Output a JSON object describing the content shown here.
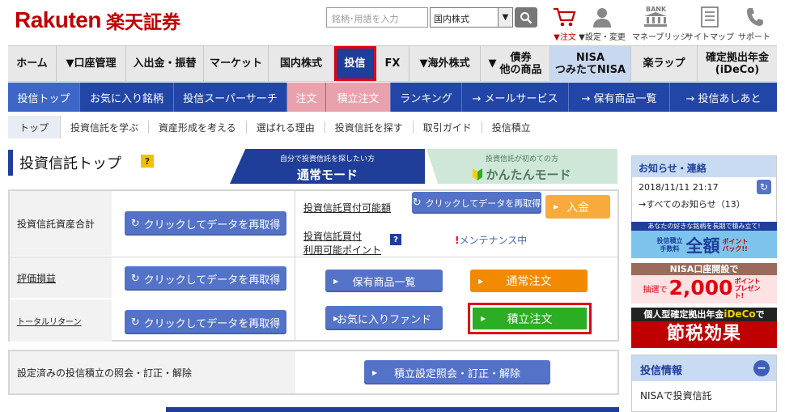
{
  "header": {
    "logo_latin": "Rakuten",
    "logo_jp": "楽天証券",
    "search_placeholder": "銘柄･用語を入力",
    "search_category": "国内株式",
    "icons": [
      {
        "name": "cart-icon",
        "label": "▼注文"
      },
      {
        "name": "user-icon",
        "label": "▼設定・変更"
      },
      {
        "name": "bank-icon",
        "label": "マネーブリッジ",
        "badge": "BANK"
      },
      {
        "name": "sitemap-icon",
        "label": "サイトマップ"
      },
      {
        "name": "phone-icon",
        "label": "サポート"
      }
    ]
  },
  "main_nav": [
    {
      "label": "ホーム"
    },
    {
      "label": "▼口座管理"
    },
    {
      "label": "入出金・振替"
    },
    {
      "label": "マーケット"
    },
    {
      "label": "国内株式"
    },
    {
      "label": "投信"
    },
    {
      "label": "FX"
    },
    {
      "label": "▼海外株式"
    },
    {
      "label": "▼",
      "label2": "債券",
      "label3": "他の商品"
    },
    {
      "label": "NISA",
      "label2": "つみたてNISA"
    },
    {
      "label": "楽ラップ"
    },
    {
      "label": "確定拠出年金",
      "label2": "(iDeCo)"
    }
  ],
  "sub_nav": [
    {
      "label": "投信トップ"
    },
    {
      "label": "お気に入り銘柄"
    },
    {
      "label": "投信スーパーサーチ"
    },
    {
      "label": "注文"
    },
    {
      "label": "積立注文"
    },
    {
      "label": "ランキング"
    },
    {
      "label": "→ メールサービス"
    },
    {
      "label": "→ 保有商品一覧"
    },
    {
      "label": "→ 投信あしあと"
    }
  ],
  "tert_nav": [
    {
      "label": "トップ"
    },
    {
      "label": "投資信託を学ぶ"
    },
    {
      "label": "資産形成を考える"
    },
    {
      "label": "選ばれる理由"
    },
    {
      "label": "投資信託を探す"
    },
    {
      "label": "取引ガイド"
    },
    {
      "label": "投信積立"
    }
  ],
  "page": {
    "title": "投資信託トップ",
    "help": "?",
    "mode_normal_sub": "自分で投資信託を探したい方",
    "mode_normal_main": "通常モード",
    "mode_easy_sub": "投資信託が初めての方",
    "mode_easy_main": "かんたんモード"
  },
  "panel": {
    "asset_total_label": "投資信託資産合計",
    "refresh_label": "クリックしてデータを再取得",
    "buying_power_label": "投資信託買付可能額",
    "deposit_label": "入金",
    "points_label_1": "投資信託買付",
    "points_label_2": "利用可能ポイント",
    "maintenance_mark": "!",
    "maintenance_text": "メンテナンス中",
    "pnl_label": "評価損益",
    "holdings_label": "保有商品一覧",
    "normal_order_label": "通常注文",
    "total_return_label": "トータルリターン",
    "favorite_funds_label": "お気に入りファンド",
    "recurring_order_label": "積立注文",
    "recurring_settings_label": "設定済みの投信積立の照会・訂正・解除",
    "recurring_settings_button": "積立設定照会・訂正・解除"
  },
  "sidebar": {
    "notice_title": "お知らせ・連絡",
    "notice_datetime": "2018/11/11 21:17",
    "notice_all": "→すべてのお知らせ（13）",
    "banner1_top": "あなたの好きな銘柄を長期で積み立て!",
    "banner1_left": "投信積立",
    "banner1_left2": "手数料",
    "banner1_main": "全額",
    "banner1_sub": "ポイントバック!!",
    "banner2_top": "NISA口座開設で",
    "banner2_pre": "抽選で",
    "banner2_main": "2,000",
    "banner2_sub": "ポイントプレゼント!",
    "banner3_top": "個人型確定拠出年金",
    "banner3_brand": "iDeCo",
    "banner3_tail": "で",
    "banner3_main": "節税効果",
    "info_title": "投信情報",
    "info_item": "NISAで投資信託"
  },
  "colors": {
    "brand_red": "#bf0000",
    "nav_blue": "#2246a8",
    "active_blue": "#1f3e9a",
    "highlight_red": "#e3000f",
    "orange": "#f18a00",
    "green": "#2bad24"
  }
}
